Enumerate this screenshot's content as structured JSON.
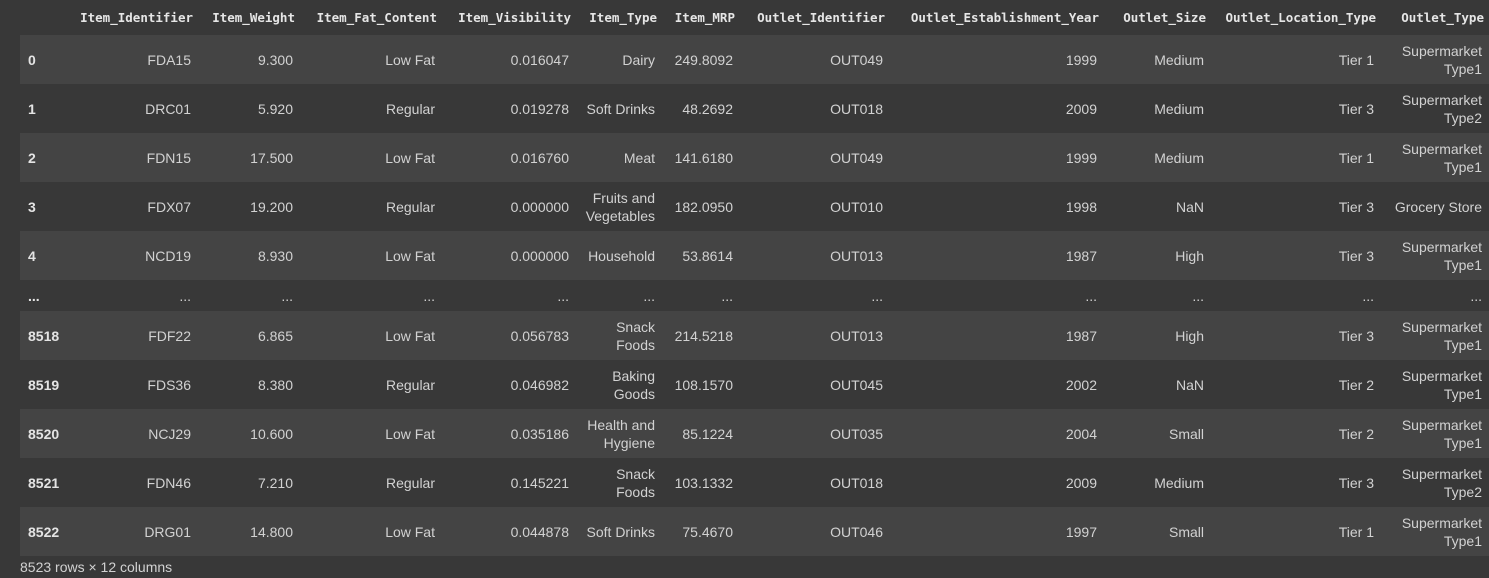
{
  "columns": [
    "Item_Identifier",
    "Item_Weight",
    "Item_Fat_Content",
    "Item_Visibility",
    "Item_Type",
    "Item_MRP",
    "Outlet_Identifier",
    "Outlet_Establishment_Year",
    "Outlet_Size",
    "Outlet_Location_Type",
    "Outlet_Type"
  ],
  "rows": [
    {
      "index": "0",
      "cells": [
        "FDA15",
        "9.300",
        "Low Fat",
        "0.016047",
        "Dairy",
        "249.8092",
        "OUT049",
        "1999",
        "Medium",
        "Tier 1",
        "Supermarket Type1"
      ]
    },
    {
      "index": "1",
      "cells": [
        "DRC01",
        "5.920",
        "Regular",
        "0.019278",
        "Soft Drinks",
        "48.2692",
        "OUT018",
        "2009",
        "Medium",
        "Tier 3",
        "Supermarket Type2"
      ]
    },
    {
      "index": "2",
      "cells": [
        "FDN15",
        "17.500",
        "Low Fat",
        "0.016760",
        "Meat",
        "141.6180",
        "OUT049",
        "1999",
        "Medium",
        "Tier 1",
        "Supermarket Type1"
      ]
    },
    {
      "index": "3",
      "cells": [
        "FDX07",
        "19.200",
        "Regular",
        "0.000000",
        "Fruits and Vegetables",
        "182.0950",
        "OUT010",
        "1998",
        "NaN",
        "Tier 3",
        "Grocery Store"
      ]
    },
    {
      "index": "4",
      "cells": [
        "NCD19",
        "8.930",
        "Low Fat",
        "0.000000",
        "Household",
        "53.8614",
        "OUT013",
        "1987",
        "High",
        "Tier 3",
        "Supermarket Type1"
      ]
    },
    {
      "index": "...",
      "cells": [
        "...",
        "...",
        "...",
        "...",
        "...",
        "...",
        "...",
        "...",
        "...",
        "...",
        "..."
      ]
    },
    {
      "index": "8518",
      "cells": [
        "FDF22",
        "6.865",
        "Low Fat",
        "0.056783",
        "Snack Foods",
        "214.5218",
        "OUT013",
        "1987",
        "High",
        "Tier 3",
        "Supermarket Type1"
      ]
    },
    {
      "index": "8519",
      "cells": [
        "FDS36",
        "8.380",
        "Regular",
        "0.046982",
        "Baking Goods",
        "108.1570",
        "OUT045",
        "2002",
        "NaN",
        "Tier 2",
        "Supermarket Type1"
      ]
    },
    {
      "index": "8520",
      "cells": [
        "NCJ29",
        "10.600",
        "Low Fat",
        "0.035186",
        "Health and Hygiene",
        "85.1224",
        "OUT035",
        "2004",
        "Small",
        "Tier 2",
        "Supermarket Type1"
      ]
    },
    {
      "index": "8521",
      "cells": [
        "FDN46",
        "7.210",
        "Regular",
        "0.145221",
        "Snack Foods",
        "103.1332",
        "OUT018",
        "2009",
        "Medium",
        "Tier 3",
        "Supermarket Type2"
      ]
    },
    {
      "index": "8522",
      "cells": [
        "DRG01",
        "14.800",
        "Low Fat",
        "0.044878",
        "Soft Drinks",
        "75.4670",
        "OUT046",
        "1997",
        "Small",
        "Tier 1",
        "Supermarket Type1"
      ]
    }
  ],
  "footer": "8523 rows × 12 columns",
  "colors": {
    "background": "#383838",
    "row_stripe": "#444444",
    "text": "#d2d2d2"
  }
}
